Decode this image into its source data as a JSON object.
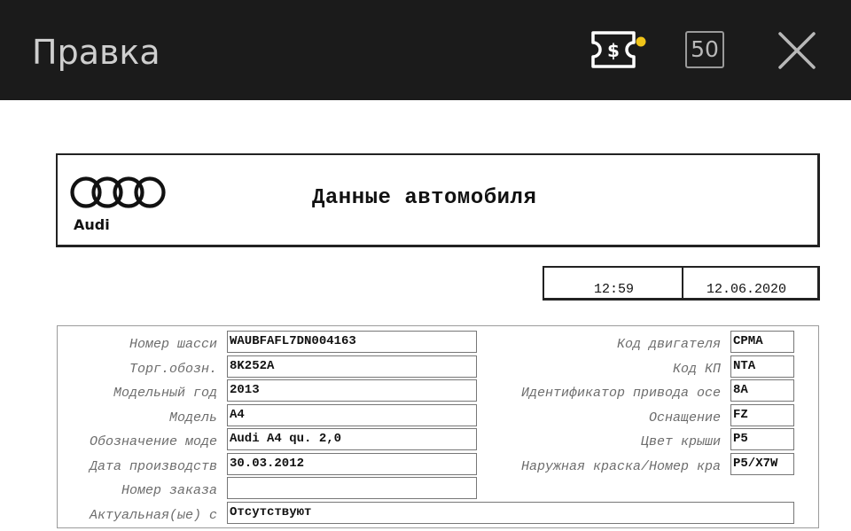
{
  "topbar": {
    "title": "Правка",
    "coupon_symbol": "$",
    "badge_count": "50",
    "colors": {
      "background": "#1b1b1b",
      "dot": "#f0c419"
    },
    "icons": [
      "coupon-icon",
      "notification-dot-icon",
      "close-icon"
    ]
  },
  "header": {
    "brand": "Audi",
    "title": "Данные автомобиля"
  },
  "datetime": {
    "time": "12:59",
    "date": "12.06.2020"
  },
  "left_fields": [
    {
      "label": "Номер шасси",
      "value": "WAUBFAFL7DN004163"
    },
    {
      "label": "Торг.обозн.",
      "value": "8K252A"
    },
    {
      "label": "Модельный год",
      "value": "2013"
    },
    {
      "label": "Модель",
      "value": "A4"
    },
    {
      "label": "Обозначение моде",
      "value": "Audi A4 qu. 2,0"
    },
    {
      "label": "Дата производств",
      "value": "30.03.2012"
    },
    {
      "label": "Номер заказа",
      "value": ""
    },
    {
      "label": "Актуальная(ые) с",
      "value": "Отсутствуют"
    }
  ],
  "right_fields": [
    {
      "label": "Код двигателя",
      "value": "CPMA"
    },
    {
      "label": "Код КП",
      "value": "NTA"
    },
    {
      "label": "Идентификатор привода осе",
      "value": "8A"
    },
    {
      "label": "Оснащение",
      "value": "FZ"
    },
    {
      "label": "Цвет крыши",
      "value": "P5"
    },
    {
      "label": "Наружная краска/Номер кра",
      "value": "P5/X7W"
    }
  ]
}
